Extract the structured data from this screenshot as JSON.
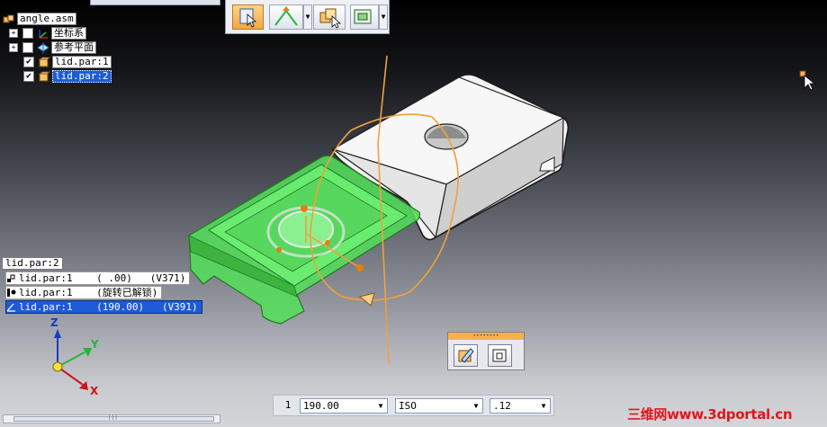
{
  "tree": {
    "root": "angle.asm",
    "items": [
      {
        "label": "坐标系",
        "checked": false,
        "expandable": true,
        "icon": "coordinate-system-icon"
      },
      {
        "label": "参考平面",
        "checked": false,
        "expandable": true,
        "icon": "reference-plane-icon"
      },
      {
        "label": "lid.par:1",
        "checked": true,
        "expandable": false,
        "icon": "part-icon"
      },
      {
        "label": "lid.par:2",
        "checked": true,
        "expandable": false,
        "icon": "part-icon",
        "selected": true
      }
    ],
    "check_mark": "✔",
    "expand_mark": "+"
  },
  "toolbar": {
    "buttons": [
      {
        "icon": "select-tool-icon",
        "active": true
      },
      {
        "icon": "relationship-icon",
        "has_dropdown": true
      },
      {
        "icon": "move-part-icon"
      },
      {
        "icon": "display-options-icon",
        "has_dropdown": true
      }
    ]
  },
  "feature_panel": {
    "title": "lid.par:2",
    "rows": [
      {
        "text": "lid.par:1    ( .00)   (V371)",
        "icon": "fixed-relation-icon"
      },
      {
        "text": "lid.par:1    (旋转已解锁)",
        "icon": "axial-align-icon"
      },
      {
        "text": "lid.par:1    (190.00)   (V391)",
        "icon": "angle-relation-icon",
        "selected": true
      }
    ]
  },
  "bottom_bar": {
    "step": "1",
    "value": "190.00",
    "standard": "ISO",
    "precision": ".12"
  },
  "triad": {
    "x": "X",
    "y": "Y",
    "z": "Z"
  },
  "watermark": "三维网www.3dportal.cn",
  "colors": {
    "selection": "#1e5bd6",
    "highlight_part": "#3dd64a",
    "sketch_orange": "#f0a040",
    "accent_orange": "#f4b24c",
    "watermark_red": "#e4141d"
  }
}
